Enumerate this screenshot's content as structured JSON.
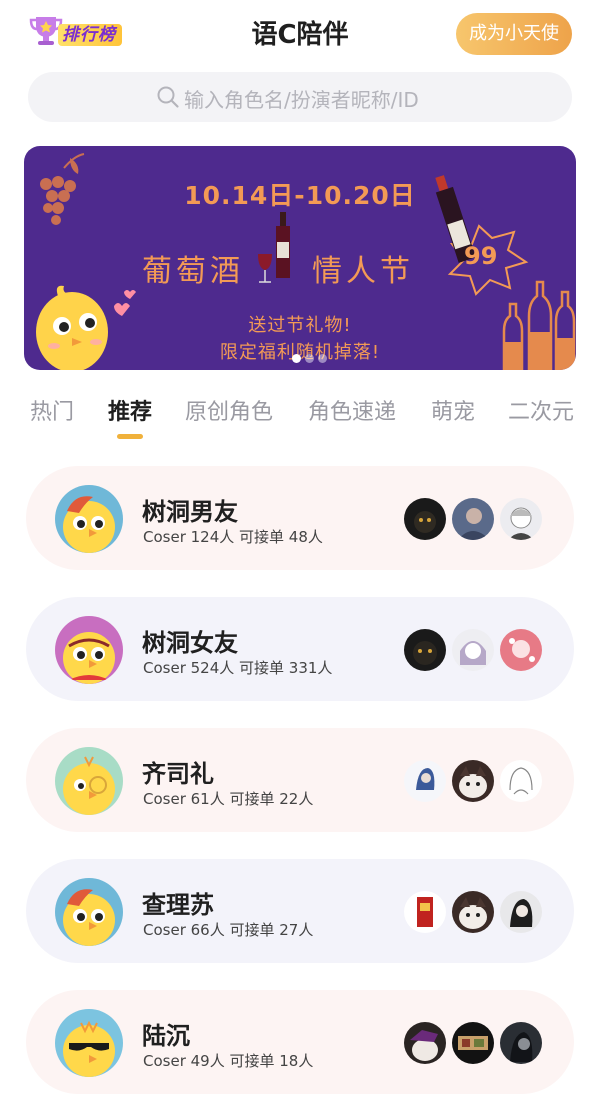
{
  "header": {
    "rank_label": "排行榜",
    "title": "语C陪伴",
    "become_button": "成为小天使"
  },
  "search": {
    "placeholder": "输入角色名/扮演者昵称/ID"
  },
  "banner": {
    "date_range": "10.14日-10.20日",
    "festival_left": "葡萄酒",
    "festival_right": "情人节",
    "gift_line1": "送过节礼物!",
    "gift_line2": "限定福利随机掉落!",
    "price_tag": "99",
    "carousel_count": 3,
    "carousel_active": 1
  },
  "tabs": [
    {
      "label": "热门",
      "active": false
    },
    {
      "label": "推荐",
      "active": true
    },
    {
      "label": "原创角色",
      "active": false
    },
    {
      "label": "角色速递",
      "active": false
    },
    {
      "label": "萌宠",
      "active": false
    },
    {
      "label": "二次元",
      "active": false
    }
  ],
  "roles": [
    {
      "name": "树洞男友",
      "stats": "Coser 124人  可接单 48人"
    },
    {
      "name": "树洞女友",
      "stats": "Coser 524人  可接单 331人"
    },
    {
      "name": "齐司礼",
      "stats": "Coser 61人  可接单 22人"
    },
    {
      "name": "查理苏",
      "stats": "Coser 66人  可接单 27人"
    },
    {
      "name": "陆沉",
      "stats": "Coser 49人  可接单 18人"
    }
  ],
  "colors": {
    "accent": "#f0b13b",
    "banner_bg": "#4e2a8e",
    "banner_text": "#f39a55",
    "card_pink": "#fdf4f3",
    "card_blue": "#f3f3fa"
  }
}
